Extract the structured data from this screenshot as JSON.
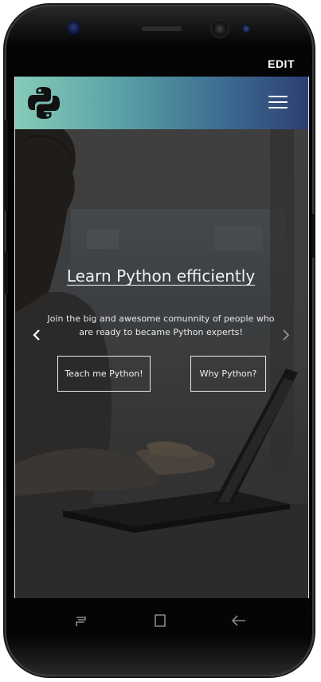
{
  "device": {
    "status_action": "EDIT"
  },
  "navbar": {
    "logo_icon": "python-logo-icon",
    "menu_icon": "hamburger-menu-icon",
    "gradient_start": "#86cbb8",
    "gradient_end": "#2c3f72"
  },
  "hero": {
    "title": "Learn Python efficiently",
    "description": "Join the big and awesome comunnity of people who are ready to became Python experts!",
    "prev_icon": "chevron-left-icon",
    "next_icon": "chevron-right-icon",
    "buttons": {
      "primary": "Teach me Python!",
      "secondary": "Why Python?"
    }
  },
  "system_nav": {
    "recent_icon": "recent-apps-icon",
    "home_icon": "home-square-icon",
    "back_icon": "back-arrow-icon"
  }
}
